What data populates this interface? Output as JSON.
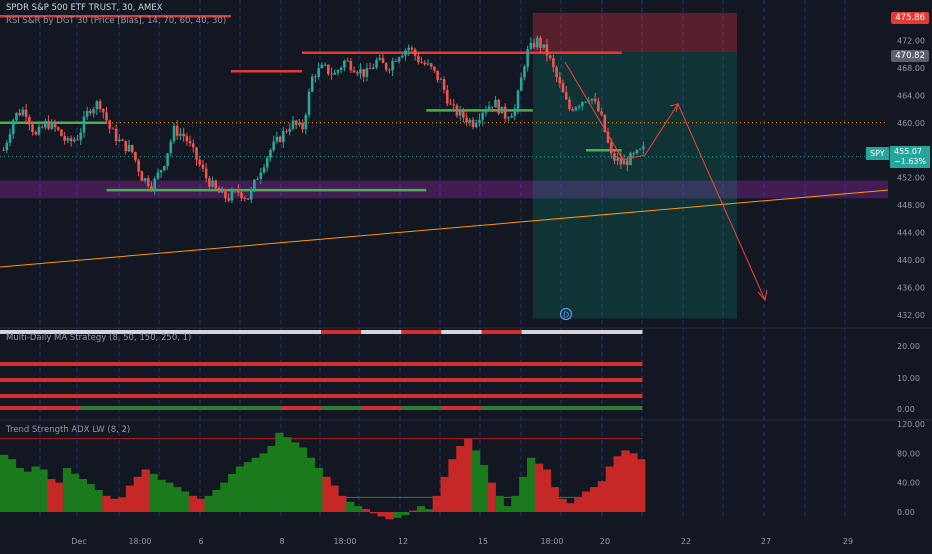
{
  "chart_data": [
    {
      "type": "candlestick",
      "title": "SPDR S&P 500 ETF TRUST, 30, AMEX",
      "indicator": "RSI S&R by DGT 30 (Price [Bias], 14, 70, 60, 40, 30)",
      "ylim": [
        431,
        477
      ],
      "y_ticks": [
        432,
        436,
        440,
        444,
        448,
        452,
        456,
        460,
        464,
        468,
        472
      ],
      "x_ticks": [
        "Dec",
        "18:00",
        "6",
        "8",
        "18:00",
        "12",
        "15",
        "18:00",
        "20",
        "22",
        "27",
        "29"
      ],
      "last_price": "455.07",
      "change": "−1.63%",
      "symbol": "SPY",
      "price_badges": [
        "475.86",
        "470.82"
      ],
      "close_path": [
        456,
        461,
        462,
        458,
        460,
        459,
        457,
        458,
        462,
        463,
        459,
        457,
        456,
        452,
        451,
        454,
        459,
        458,
        455,
        452,
        450,
        449,
        450,
        449,
        453,
        456,
        458,
        460,
        459,
        467,
        468,
        467,
        469,
        468,
        467,
        469,
        468,
        470,
        471,
        469,
        468,
        466,
        462,
        461,
        460,
        462,
        463,
        461,
        462,
        470,
        472,
        470,
        466,
        462,
        463,
        464,
        461,
        455,
        454,
        455,
        456
      ],
      "levels": [
        {
          "price": 475.5,
          "color": "#e53935",
          "from": 0.0,
          "to": 0.26
        },
        {
          "price": 460.0,
          "color": "#4caf50",
          "from": 0.0,
          "to": 0.12
        },
        {
          "price": 467.5,
          "color": "#e53935",
          "from": 0.26,
          "to": 0.34
        },
        {
          "price": 470.2,
          "color": "#e53935",
          "from": 0.34,
          "to": 0.7
        },
        {
          "price": 461.8,
          "color": "#4caf50",
          "from": 0.48,
          "to": 0.6
        },
        {
          "price": 450.2,
          "color": "#4caf50",
          "from": 0.12,
          "to": 0.48
        },
        {
          "price": 456.0,
          "color": "#4caf50",
          "from": 0.66,
          "to": 0.7
        }
      ],
      "zone": {
        "low": 449.0,
        "high": 451.6,
        "color": "#9c27b0"
      },
      "trendline": {
        "from": [
          0,
          439.0
        ],
        "to": [
          1,
          450.2
        ],
        "color": "#ff9800"
      },
      "short_position": {
        "entry": 470.3,
        "stop": 476.0,
        "target": 431.5,
        "x_from": 0.6,
        "x_to": 0.83
      }
    },
    {
      "type": "heatmap",
      "title": "Multi-Daily MA Strategy (8, 50, 150, 250, 1)",
      "y_ticks": [
        "20.00",
        "10.00",
        "0.00"
      ]
    },
    {
      "type": "histogram",
      "title": "Trend Strength ADX LW (8, 2)",
      "ylim": [
        0,
        120
      ],
      "y_ticks": [
        "120.00",
        "80.00",
        "40.00",
        "0.00"
      ],
      "values": [
        78,
        72,
        60,
        55,
        62,
        58,
        45,
        40,
        60,
        52,
        45,
        38,
        30,
        22,
        18,
        20,
        36,
        48,
        58,
        52,
        44,
        40,
        34,
        28,
        22,
        18,
        22,
        30,
        40,
        52,
        62,
        68,
        74,
        80,
        90,
        108,
        102,
        95,
        88,
        74,
        60,
        48,
        36,
        22,
        14,
        8,
        4,
        -2,
        -6,
        -10,
        -8,
        -4,
        2,
        8,
        4,
        22,
        48,
        72,
        90,
        100,
        84,
        64,
        40,
        22,
        8,
        22,
        48,
        74,
        66,
        58,
        34,
        18,
        12,
        20,
        28,
        34,
        42,
        62,
        76,
        84,
        80,
        72
      ],
      "signs": [
        "g",
        "g",
        "g",
        "g",
        "g",
        "g",
        "r",
        "r",
        "g",
        "g",
        "g",
        "g",
        "g",
        "r",
        "r",
        "r",
        "r",
        "r",
        "r",
        "g",
        "g",
        "g",
        "g",
        "g",
        "r",
        "r",
        "g",
        "g",
        "g",
        "g",
        "g",
        "g",
        "g",
        "g",
        "g",
        "g",
        "g",
        "g",
        "g",
        "g",
        "g",
        "r",
        "r",
        "r",
        "g",
        "g",
        "r",
        "r",
        "r",
        "r",
        "g",
        "g",
        "r",
        "g",
        "g",
        "r",
        "r",
        "r",
        "r",
        "r",
        "g",
        "g",
        "r",
        "g",
        "g",
        "g",
        "g",
        "g",
        "r",
        "r",
        "r",
        "r",
        "r",
        "r",
        "r",
        "r",
        "r",
        "r",
        "r",
        "r",
        "r",
        "r"
      ]
    }
  ]
}
